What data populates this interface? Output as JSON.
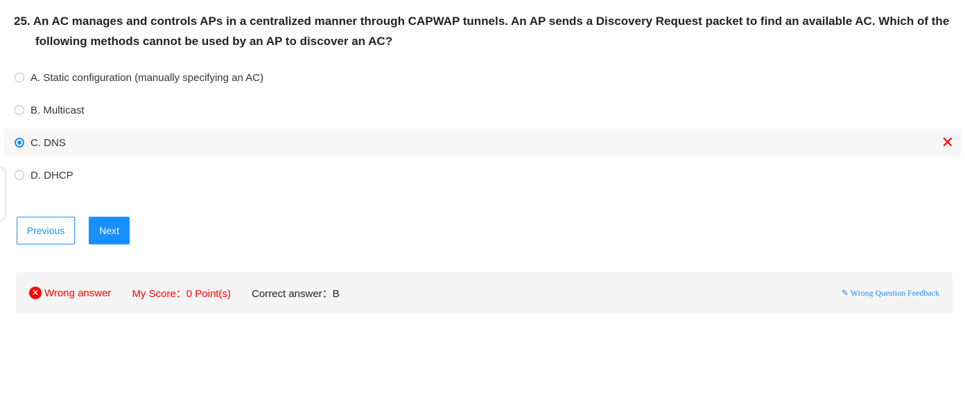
{
  "question": "25. An AC manages and controls APs in a centralized manner through CAPWAP tunnels. An AP sends a Discovery Request packet to find an available AC. Which of the following methods cannot be used by an AP to discover an AC?",
  "options": [
    {
      "label": "A. Static configuration (manually specifying an AC)"
    },
    {
      "label": "B. Multicast"
    },
    {
      "label": "C. DNS"
    },
    {
      "label": "D. DHCP"
    }
  ],
  "selected": "C",
  "wrong_mark": "✕",
  "buttons": {
    "previous": "Previous",
    "next": "Next"
  },
  "result": {
    "status": "Wrong answer",
    "score": "My Score：0 Point(s)",
    "correct": "Correct answer：B",
    "feedback": "Wrong Question Feedback",
    "feedback_icon": "✎"
  },
  "colors": {
    "accent": "#1890ff",
    "error": "#ff0000"
  }
}
